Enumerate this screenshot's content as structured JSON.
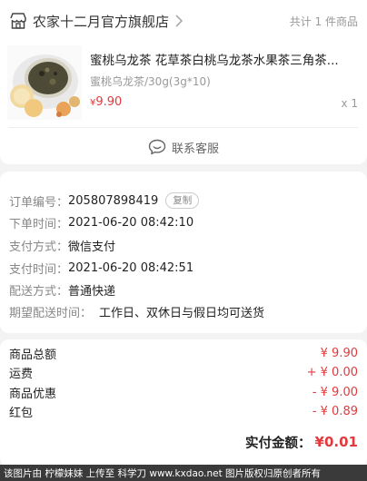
{
  "shop": {
    "name": "农家十二月官方旗舰店",
    "item_count": "共计 1 件商品"
  },
  "product": {
    "title": "蜜桃乌龙茶 花草茶白桃乌龙茶水果茶三角茶...",
    "spec": "蜜桃乌龙茶/30g(3g*10)",
    "currency": "¥",
    "price": "9.90",
    "quantity": "x 1"
  },
  "customer_service": {
    "label": "联系客服"
  },
  "order_info": {
    "order_no_label": "订单编号：",
    "order_no": "205807898419",
    "copy_label": "复制",
    "order_time_label": "下单时间：",
    "order_time": "2021-06-20 08:42:10",
    "pay_method_label": "支付方式：",
    "pay_method": "微信支付",
    "pay_time_label": "支付时间：",
    "pay_time": "2021-06-20 08:42:51",
    "delivery_method_label": "配送方式：",
    "delivery_method": "普通快递",
    "expected_delivery_label": "期望配送时间：",
    "expected_delivery": "工作日、双休日与假日均可送货"
  },
  "summary": {
    "rows": [
      {
        "label": "商品总额",
        "value": "¥ 9.90"
      },
      {
        "label": "运费",
        "value": "+ ¥ 0.00"
      },
      {
        "label": "商品优惠",
        "value": "- ¥ 9.00"
      },
      {
        "label": "红包",
        "value": "- ¥ 0.89"
      }
    ],
    "total_label": "实付金额：",
    "total_value": "¥0.01"
  },
  "watermark": "该图片由 柠檬妹妹 上传至 科学刀 www.kxdao.net 图片版权归原创者所有",
  "colors": {
    "accent": "#e4393c",
    "muted": "#999999"
  }
}
